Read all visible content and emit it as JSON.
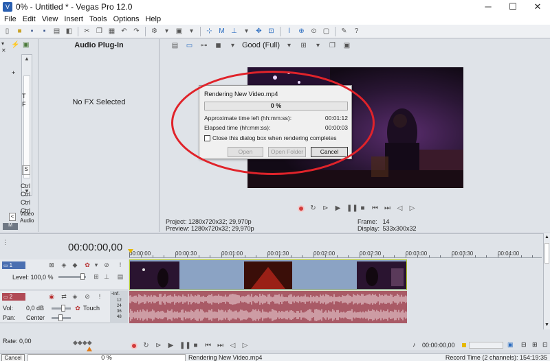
{
  "window": {
    "title": "0% - Untitled * - Vegas Pro 12.0",
    "minimize": "─",
    "maximize": "☐",
    "close": "✕"
  },
  "menu": [
    "File",
    "Edit",
    "View",
    "Insert",
    "Tools",
    "Options",
    "Help"
  ],
  "explorer": {
    "small_labels": [
      "T",
      "F"
    ],
    "bottom_labels": [
      "Ctrl",
      "Ctrl",
      "Ctrl",
      "Ctrl"
    ],
    "video_label": "Video",
    "audio_label": "Audio"
  },
  "plugin_panel": {
    "title": "Audio Plug-In",
    "empty_text": "No FX Selected"
  },
  "preview": {
    "quality": "Good (Full)",
    "project_label": "Project:",
    "project_value": "1280x720x32; 29,970p",
    "preview_label": "Preview:",
    "preview_value": "1280x720x32; 29,970p",
    "frame_label": "Frame:",
    "frame_value": "14",
    "display_label": "Display:",
    "display_value": "533x300x32"
  },
  "dialog": {
    "title": "Rendering New Video.mp4",
    "progress_text": "0 %",
    "progress_fraction": 0.0,
    "time_left_label": "Approximate time left (hh:mm:ss):",
    "time_left_value": "00:01:12",
    "elapsed_label": "Elapsed time (hh:mm:ss):",
    "elapsed_value": "00:00:03",
    "checkbox_label": "Close this dialog box when rendering completes",
    "open_button": "Open",
    "open_folder_button": "Open Folder",
    "cancel_button": "Cancel"
  },
  "timeline": {
    "current_time": "00:00:00,00",
    "ruler": [
      "00:00:00",
      "00:00:30",
      "00:01:00",
      "00:01:30",
      "00:02:00",
      "00:02:30",
      "00:03:00",
      "00:03:30",
      "00:04:00"
    ],
    "video_track": {
      "number": "1",
      "level_label": "Level: 100,0 %"
    },
    "audio_track": {
      "number": "2",
      "vol_label": "Vol:",
      "vol_value": "0,0 dB",
      "pan_label": "Pan:",
      "pan_value": "Center",
      "mode": "Touch",
      "meter_top": "-Inf.",
      "meter_marks": [
        "12",
        "24",
        "36",
        "48"
      ]
    },
    "rate": "Rate: 0,00",
    "bottom_time": "00:00:00,00"
  },
  "status": {
    "cancel_button": "Cancel",
    "progress_text": "0 %",
    "render_text": "Rendering New Video.mp4",
    "record_time": "Record Time (2 channels): 154:19:35"
  },
  "colors": {
    "annotation": "#e0232a",
    "video_track": "#4a6fb1",
    "audio_track": "#b04a55",
    "video_lane": "#8ba3c4",
    "audio_lane": "#a95a66"
  }
}
